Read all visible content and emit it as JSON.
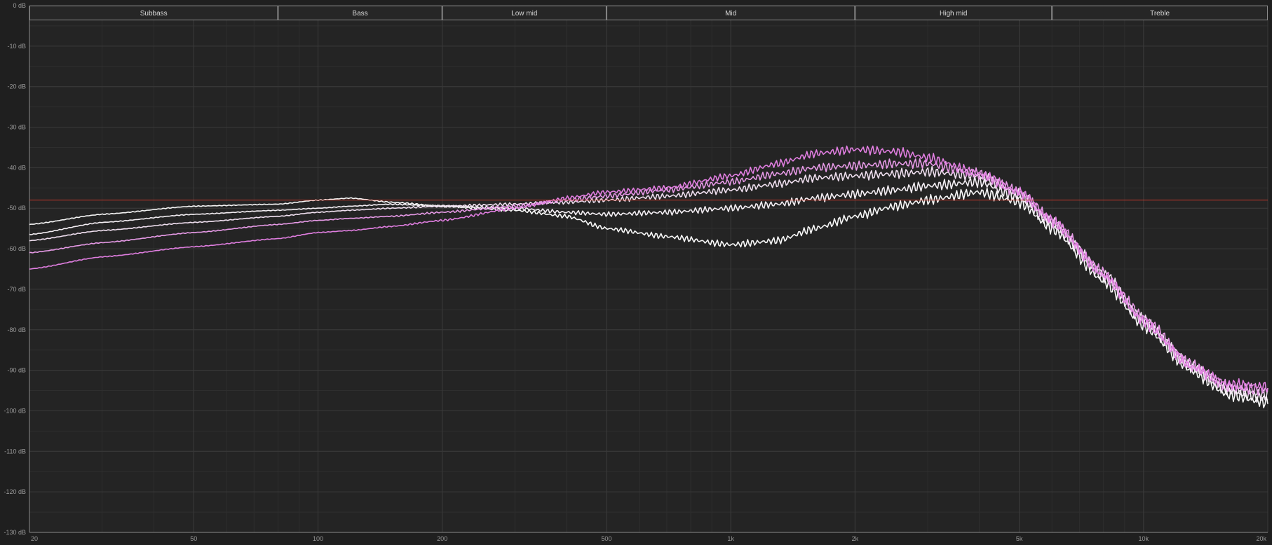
{
  "colors": {
    "background": "#1f1f1f",
    "plot_background": "#242424",
    "grid_major": "#3a3a3a",
    "grid_minor": "#2e2e2e",
    "band_border": "#8a8a8a",
    "reference_line": "#c0392b",
    "curve_white": "#f5f5f5",
    "curve_pink": "#e07ee0"
  },
  "bands": [
    {
      "label": "Subbass",
      "from_hz": 20,
      "to_hz": 80
    },
    {
      "label": "Bass",
      "from_hz": 80,
      "to_hz": 200
    },
    {
      "label": "Low mid",
      "from_hz": 200,
      "to_hz": 500
    },
    {
      "label": "Mid",
      "from_hz": 500,
      "to_hz": 2000
    },
    {
      "label": "High mid",
      "from_hz": 2000,
      "to_hz": 6000
    },
    {
      "label": "Treble",
      "from_hz": 6000,
      "to_hz": 20000
    }
  ],
  "chart_data": {
    "type": "line",
    "x_scale": "log",
    "xlim": [
      20,
      20000
    ],
    "ylim": [
      -130,
      0
    ],
    "grid": true,
    "x_ticks": [
      {
        "value": 20,
        "label": "20"
      },
      {
        "value": 50,
        "label": "50"
      },
      {
        "value": 100,
        "label": "100"
      },
      {
        "value": 200,
        "label": "200"
      },
      {
        "value": 500,
        "label": "500"
      },
      {
        "value": 1000,
        "label": "1k"
      },
      {
        "value": 2000,
        "label": "2k"
      },
      {
        "value": 5000,
        "label": "5k"
      },
      {
        "value": 10000,
        "label": "10k"
      },
      {
        "value": 20000,
        "label": "20k"
      }
    ],
    "y_ticks": [
      {
        "value": 0,
        "label": "0 dB"
      },
      {
        "value": -10,
        "label": "-10 dB"
      },
      {
        "value": -20,
        "label": "-20 dB"
      },
      {
        "value": -30,
        "label": "-30 dB"
      },
      {
        "value": -40,
        "label": "-40 dB"
      },
      {
        "value": -50,
        "label": "-50 dB"
      },
      {
        "value": -60,
        "label": "-60 dB"
      },
      {
        "value": -70,
        "label": "-70 dB"
      },
      {
        "value": -80,
        "label": "-80 dB"
      },
      {
        "value": -90,
        "label": "-90 dB"
      },
      {
        "value": -100,
        "label": "-100 dB"
      },
      {
        "value": -110,
        "label": "-110 dB"
      },
      {
        "value": -120,
        "label": "-120 dB"
      },
      {
        "value": -130,
        "label": "-130 dB"
      }
    ],
    "reference_level_db": -48,
    "series": [
      {
        "color": "#f5f5f5",
        "x": [
          20,
          30,
          50,
          80,
          100,
          120,
          150,
          200,
          300,
          400,
          500,
          700,
          1000,
          1300,
          1600,
          2000,
          2500,
          3000,
          4000,
          5000,
          6000,
          8000,
          10000,
          13000,
          16000,
          20000
        ],
        "y": [
          -54,
          -51.5,
          -49.5,
          -49,
          -48,
          -47.5,
          -48.5,
          -49.5,
          -50.5,
          -52,
          -55,
          -57,
          -59,
          -58,
          -55,
          -52,
          -49.5,
          -48,
          -46,
          -48.5,
          -55,
          -68,
          -79,
          -90,
          -96,
          -98
        ]
      },
      {
        "color": "#f3eef3",
        "x": [
          20,
          30,
          50,
          80,
          100,
          120,
          150,
          200,
          300,
          400,
          500,
          700,
          1000,
          1300,
          1600,
          2000,
          2500,
          3000,
          4000,
          5000,
          6000,
          8000,
          10000,
          13000,
          16000,
          20000
        ],
        "y": [
          -56.5,
          -53.5,
          -51.5,
          -50.5,
          -50,
          -49.5,
          -49,
          -49.5,
          -50,
          -51,
          -51.5,
          -51,
          -50,
          -49,
          -47.5,
          -46.5,
          -45.5,
          -44.5,
          -43.5,
          -47.5,
          -54,
          -67,
          -78,
          -89,
          -95,
          -97
        ]
      },
      {
        "color": "#f0e0f0",
        "x": [
          20,
          30,
          50,
          80,
          100,
          120,
          150,
          200,
          300,
          400,
          500,
          700,
          1000,
          1300,
          1600,
          2000,
          2500,
          3000,
          4000,
          5000,
          6000,
          8000,
          10000,
          13000,
          16000,
          20000
        ],
        "y": [
          -58,
          -55.5,
          -53.5,
          -52,
          -51,
          -50.5,
          -50,
          -49.5,
          -49,
          -48.5,
          -48,
          -47,
          -45.5,
          -44,
          -42.5,
          -42,
          -41.5,
          -41,
          -42,
          -46.5,
          -53.5,
          -66,
          -77.5,
          -89,
          -94.5,
          -96
        ]
      },
      {
        "color": "#e89be8",
        "x": [
          20,
          30,
          50,
          80,
          100,
          120,
          150,
          200,
          300,
          400,
          500,
          700,
          1000,
          1300,
          1600,
          2000,
          2500,
          3000,
          4000,
          5000,
          6000,
          8000,
          10000,
          13000,
          16000,
          20000
        ],
        "y": [
          -61,
          -58.5,
          -56,
          -54,
          -53,
          -52.5,
          -52,
          -51,
          -49.5,
          -48,
          -47,
          -45.5,
          -43.5,
          -41.5,
          -40,
          -39.5,
          -39,
          -39,
          -41.5,
          -46,
          -53,
          -66,
          -77,
          -88.5,
          -94,
          -95
        ]
      },
      {
        "color": "#e07ee0",
        "x": [
          20,
          30,
          50,
          80,
          100,
          120,
          150,
          200,
          300,
          400,
          500,
          700,
          1000,
          1300,
          1600,
          2000,
          2500,
          3000,
          4000,
          5000,
          6000,
          8000,
          10000,
          13000,
          16000,
          20000
        ],
        "y": [
          -65,
          -62,
          -59.5,
          -57.5,
          -56,
          -55.5,
          -54.5,
          -53,
          -50,
          -47.5,
          -46,
          -45,
          -42,
          -39,
          -36.5,
          -35.5,
          -36,
          -37.5,
          -41.5,
          -46,
          -53,
          -66.5,
          -78,
          -89,
          -93.5,
          -94
        ]
      }
    ]
  }
}
